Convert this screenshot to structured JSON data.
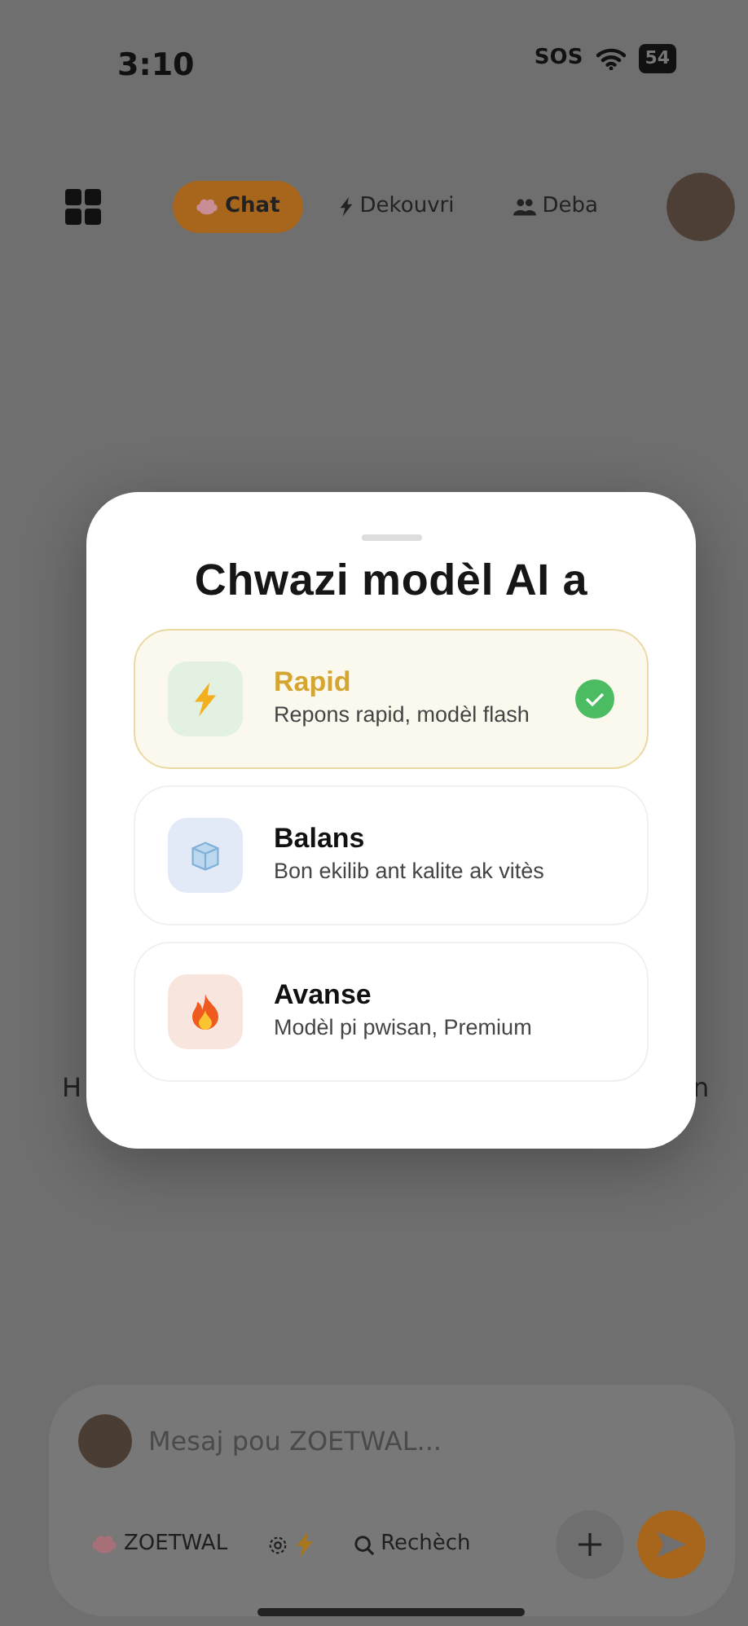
{
  "status_bar": {
    "time": "3:10",
    "carrier": "SOS",
    "battery": "54"
  },
  "nav": {
    "tabs": [
      {
        "label": "Chat",
        "kind": "brain",
        "selected": true
      },
      {
        "label": "Dekouvri",
        "kind": "bolt",
        "selected": false
      },
      {
        "label": "Deba",
        "kind": "people",
        "selected": false
      }
    ]
  },
  "covered_text": [
    "H",
    "n"
  ],
  "modal": {
    "title": "Chwazi modèl AI a",
    "options": [
      {
        "name": "Rapid",
        "description": "Repons rapid, modèl flash",
        "kind": "bolt",
        "color": "#e2f1e2",
        "selected": true
      },
      {
        "name": "Balans",
        "description": "Bon ekilib ant kalite ak vitès",
        "kind": "ice",
        "color": "#e2e9f7",
        "selected": false
      },
      {
        "name": "Avanse",
        "description": "Modèl pi pwisan, Premium",
        "kind": "fire",
        "color": "#f8e6de",
        "selected": false
      }
    ]
  },
  "composer": {
    "placeholder": "Mesaj pou ZOETWAL...",
    "model_chip": "ZOETWAL",
    "search": "Rechèch"
  }
}
